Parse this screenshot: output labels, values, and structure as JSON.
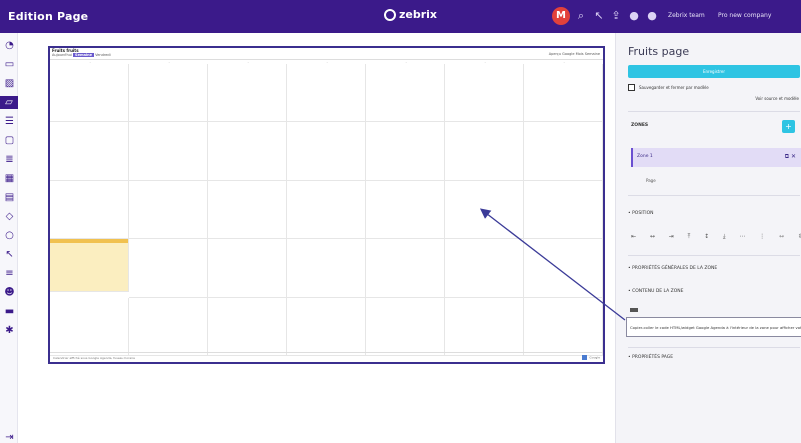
{
  "app": {
    "title": "Edition Page",
    "logo": "zebrix"
  },
  "topbar": {
    "avatar_initial": "M",
    "icons": [
      "search-icon",
      "pointer-icon",
      "share-icon",
      "user-icon",
      "user-icon-2"
    ],
    "links": [
      "Zebrix team",
      "Pro new company"
    ]
  },
  "sidebar": {
    "items": [
      "dashboard-icon",
      "screen-icon",
      "image-icon",
      "folder-icon",
      "playlist-icon",
      "window-icon",
      "list-icon",
      "calendar-icon",
      "doc-icon",
      "tag-icon",
      "circle-icon",
      "wand-icon",
      "stack-icon",
      "users-icon",
      "screens-icon",
      "settings-icon"
    ],
    "active_index": 3,
    "footer_icon": "logout-icon"
  },
  "canvas": {
    "frame_title": "Fruits fruits",
    "frame_nav": [
      "Aujourd'hui",
      "Semaine",
      "Vendredi"
    ],
    "frame_right": [
      "Aperçu",
      "Google",
      "Mois",
      "Semaine"
    ],
    "footer_left": "Calendrier affiché sous Google Agenda, fuseau horaire",
    "footer_right": "Google"
  },
  "panel": {
    "title": "Fruits page",
    "cta_label": "Enregistrer",
    "checkbox_label": "Sauvegarder et fermer par modèle",
    "link_label": "Voir source et modèle",
    "zones_label": "ZONES",
    "add_label": "+",
    "zone_row_label": "Zone 1",
    "sub_item_label": "Page",
    "section_position": "• POSITION",
    "section_props": "• PROPRIÉTÉS GÉNÉRALES DE LA ZONE",
    "section_content": "• CONTENU DE LA ZONE",
    "section_page": "• PROPRIÉTÉS PAGE",
    "tooltip": "Copier-coller le code HTML/widget Google Agenda à l'intérieur de la zone pour afficher votre agenda personnalisé"
  },
  "colors": {
    "brand": "#3b1a8a",
    "accent": "#2ec4e3",
    "highlight": "#fbeec0",
    "arrow": "#3b3b98"
  }
}
